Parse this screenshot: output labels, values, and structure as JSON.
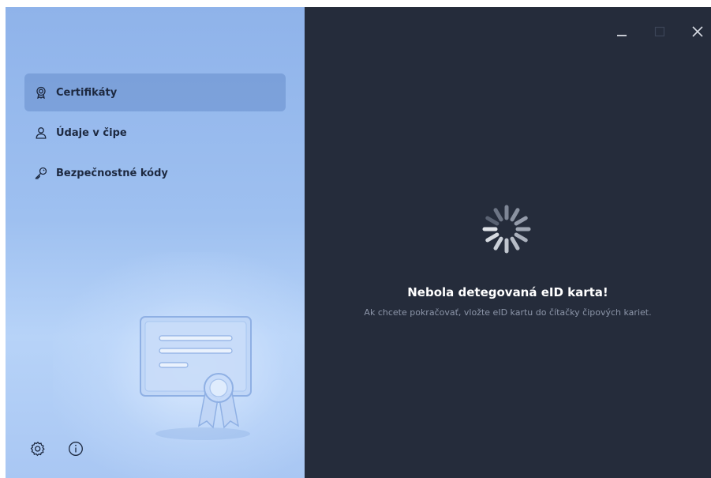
{
  "sidebar": {
    "items": [
      {
        "label": "Certifikáty",
        "icon": "certificate-badge-icon",
        "active": true
      },
      {
        "label": "Údaje v čipe",
        "icon": "user-icon",
        "active": false
      },
      {
        "label": "Bezpečnostné kódy",
        "icon": "key-icon",
        "active": false
      }
    ],
    "bottom_icons": [
      "settings-gear-icon",
      "info-icon"
    ]
  },
  "window_controls": [
    "minimize-icon",
    "maximize-icon",
    "close-icon"
  ],
  "main": {
    "status_title": "Nebola detegovaná eID karta!",
    "status_message": "Ak chcete pokračovať, vložte eID kartu do čítačky čipových kariet."
  },
  "colors": {
    "sidebar_bg": "#9ec0f0",
    "active_item_bg": "#7f9fd4",
    "main_bg": "#252c3b",
    "title_text": "#ffffff",
    "subtitle_text": "#8c95a8"
  }
}
